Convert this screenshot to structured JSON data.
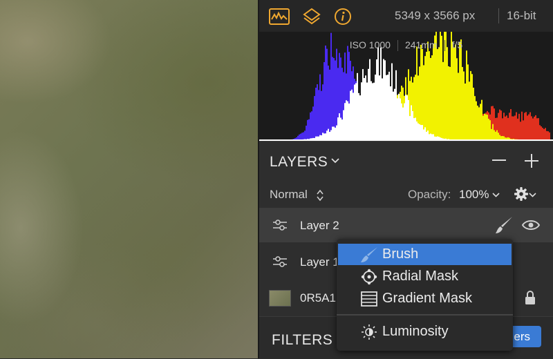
{
  "colors": {
    "accent": "#f0a830",
    "selection": "#3a7bd5"
  },
  "toolbar": {
    "icons": [
      "histogram-icon",
      "layers-stack-icon",
      "info-icon"
    ],
    "dimensions": "5349 x 3566 px",
    "bit_depth": "16-bit"
  },
  "histogram": {
    "exif": {
      "iso": "ISO 1000",
      "focal": "241mm",
      "aperture": "f/5"
    }
  },
  "layers": {
    "title": "LAYERS",
    "blend_mode": "Normal",
    "opacity_label": "Opacity:",
    "opacity_value": "100%",
    "items": [
      {
        "name": "Layer 2",
        "type": "adjustment",
        "selected": true,
        "visible": true
      },
      {
        "name": "Layer 1",
        "type": "adjustment",
        "selected": false
      },
      {
        "name": "0R5A1",
        "type": "image",
        "locked": true
      }
    ]
  },
  "mask_menu": {
    "items": [
      {
        "label": "Brush",
        "icon": "brush-icon",
        "active": true
      },
      {
        "label": "Radial Mask",
        "icon": "radial-mask-icon"
      },
      {
        "label": "Gradient Mask",
        "icon": "gradient-mask-icon"
      },
      {
        "label": "Luminosity",
        "icon": "luminosity-icon"
      }
    ]
  },
  "filters": {
    "title": "FILTERS",
    "add_button_label": "ers"
  }
}
